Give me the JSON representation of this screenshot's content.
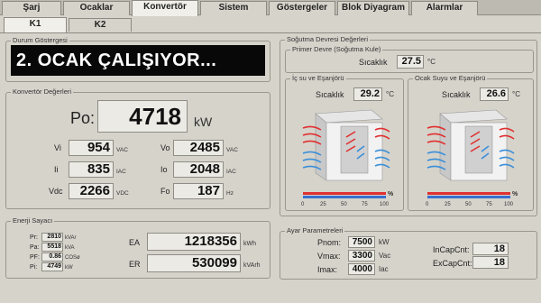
{
  "tabs": [
    "Şarj",
    "Ocaklar",
    "Konvertör",
    "Sistem",
    "Göstergeler",
    "Blok Diyagram",
    "Alarmlar"
  ],
  "subtabs": [
    "K1",
    "K2"
  ],
  "status": {
    "title": "Durum Göstergesi",
    "text": "2. OCAK ÇALIŞIYOR..."
  },
  "conv": {
    "title": "Konvertör Değerleri",
    "po_label": "Po:",
    "po_value": "4718",
    "po_unit": "kW",
    "vi_label": "Vi",
    "vi_value": "954",
    "vi_unit": "VAC",
    "vo_label": "Vo",
    "vo_value": "2485",
    "vo_unit": "VAC",
    "ii_label": "Ii",
    "ii_value": "835",
    "ii_unit": "IAC",
    "io_label": "Io",
    "io_value": "2048",
    "io_unit": "IAC",
    "vdc_label": "Vdc",
    "vdc_value": "2266",
    "vdc_unit": "VDC",
    "fo_label": "Fo",
    "fo_value": "187",
    "fo_unit": "Hz"
  },
  "energy": {
    "title": "Enerji Sayacı",
    "pr_label": "Pr:",
    "pr_value": "2810",
    "pr_unit": "kVAr",
    "pa_label": "Pa:",
    "pa_value": "5518",
    "pa_unit": "kVA",
    "pf_label": "PF:",
    "pf_value": "0.86",
    "pf_unit": "COSø",
    "pi_label": "Pi:",
    "pi_value": "4749",
    "pi_unit": "kW",
    "ea_label": "EA",
    "ea_value": "1218356",
    "ea_unit": "kWh",
    "er_label": "ER",
    "er_value": "530099",
    "er_unit": "kVArh"
  },
  "cooling": {
    "title": "Soğutma Devresi Değerleri",
    "primer_title": "Primer Devre (Soğutma Kule)",
    "primer_label": "Sıcaklık",
    "primer_value": "27.5",
    "primer_unit": "°C",
    "inner_title": "İç su ve Eşanjörü",
    "inner_label": "Sıcaklık",
    "inner_value": "29.2",
    "inner_unit": "°C",
    "ocak_title": "Ocak Suyu ve Eşanjörü",
    "ocak_label": "Sıcaklık",
    "ocak_value": "26.6",
    "ocak_unit": "°C",
    "scale": [
      "0",
      "25",
      "50",
      "75",
      "100"
    ],
    "pct": "%"
  },
  "params": {
    "title": "Ayar Parametreleri",
    "pnom_label": "Pnom:",
    "pnom_value": "7500",
    "pnom_unit": "kW",
    "vmax_label": "Vmax:",
    "vmax_value": "3300",
    "vmax_unit": "Vac",
    "imax_label": "Imax:",
    "imax_value": "4000",
    "imax_unit": "Iac",
    "incap_label": "InCapCnt:",
    "incap_value": "18",
    "excap_label": "ExCapCnt:",
    "excap_value": "18"
  }
}
